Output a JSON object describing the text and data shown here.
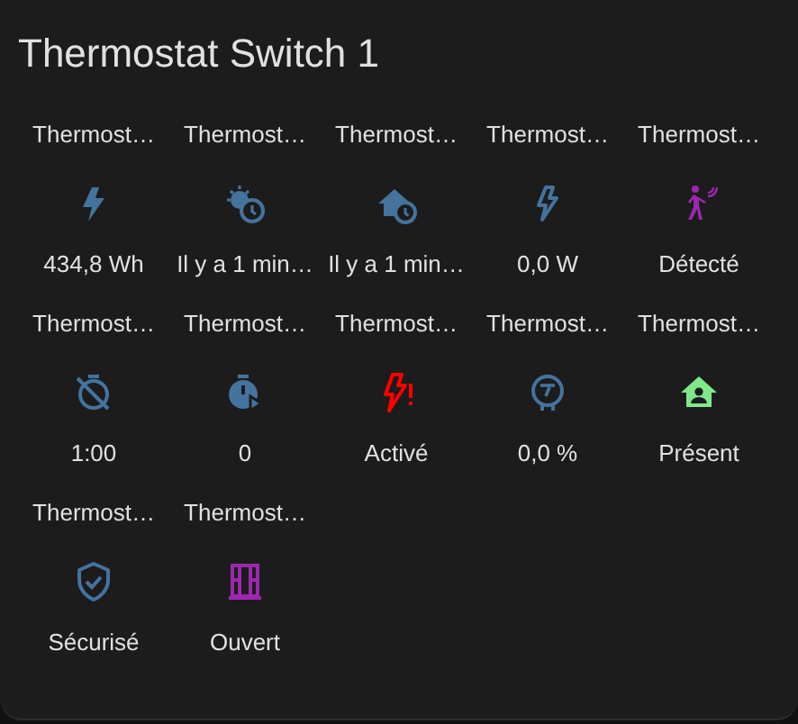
{
  "card": {
    "title": "Thermostat Switch 1",
    "entities": [
      {
        "name": "Thermost…",
        "kind": "bolt",
        "color": "#44739e",
        "state": "434,8 Wh"
      },
      {
        "name": "Thermost…",
        "kind": "weather-clock",
        "color": "#44739e",
        "state": "Il y a 1 min…"
      },
      {
        "name": "Thermost…",
        "kind": "home-clock",
        "color": "#44739e",
        "state": "Il y a 1 min…"
      },
      {
        "name": "Thermost…",
        "kind": "bolt-outline",
        "color": "#44739e",
        "state": "0,0 W"
      },
      {
        "name": "Thermost…",
        "kind": "motion",
        "color": "#9c27b0",
        "state": "Détecté"
      },
      {
        "name": "Thermost…",
        "kind": "timer-off",
        "color": "#44739e",
        "state": "1:00"
      },
      {
        "name": "Thermost…",
        "kind": "timer-play",
        "color": "#44739e",
        "state": "0"
      },
      {
        "name": "Thermost…",
        "kind": "bolt-alert",
        "color": "#ff0000",
        "state": "Activé"
      },
      {
        "name": "Thermost…",
        "kind": "gauge",
        "color": "#44739e",
        "state": "0,0 %"
      },
      {
        "name": "Thermost…",
        "kind": "home-person",
        "color": "#7ee88a",
        "state": "Présent"
      },
      {
        "name": "Thermost…",
        "kind": "shield-check",
        "color": "#44739e",
        "state": "Sécurisé"
      },
      {
        "name": "Thermost…",
        "kind": "window",
        "color": "#9c27b0",
        "state": "Ouvert"
      }
    ]
  }
}
